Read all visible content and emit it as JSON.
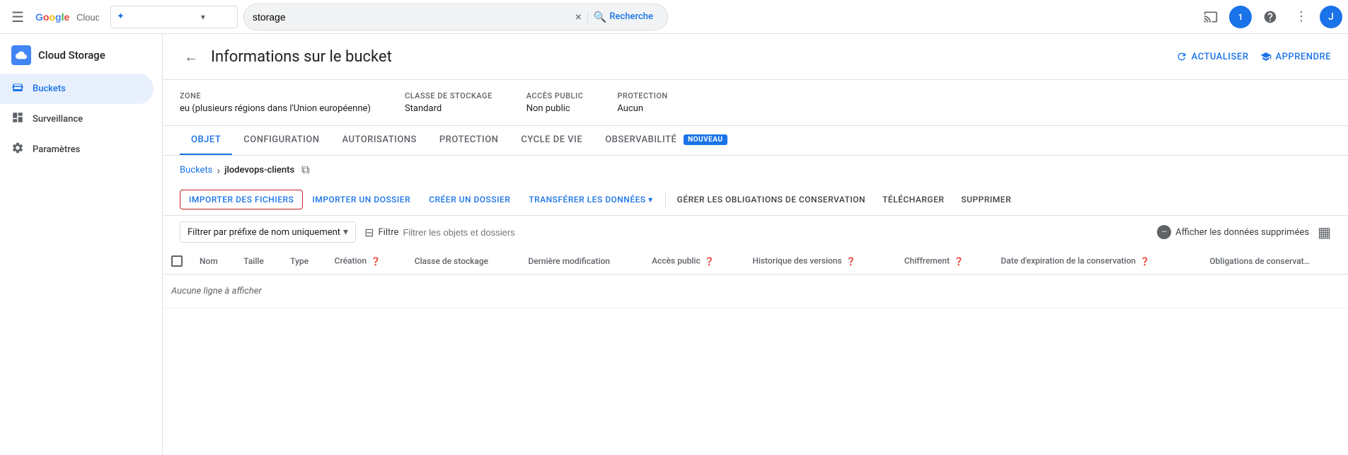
{
  "topbar": {
    "menu_icon": "☰",
    "logo_google": "Google",
    "logo_cloud": "Cloud",
    "project_selector_placeholder": "",
    "search_value": "storage",
    "search_clear_label": "×",
    "search_btn_label": "Recherche",
    "cast_icon": "⬡",
    "notification_count": "1",
    "help_icon": "?",
    "more_icon": "⋮",
    "avatar_letter": "J"
  },
  "sidebar": {
    "product_name": "Cloud Storage",
    "items": [
      {
        "id": "buckets",
        "label": "Buckets",
        "icon": "🪣",
        "active": true
      },
      {
        "id": "surveillance",
        "label": "Surveillance",
        "icon": "📊",
        "active": false
      },
      {
        "id": "parametres",
        "label": "Paramètres",
        "icon": "⚙",
        "active": false
      }
    ]
  },
  "page": {
    "back_label": "←",
    "title": "Informations sur le bucket",
    "refresh_label": "ACTUALISER",
    "learn_label": "APPRENDRE"
  },
  "bucket_info": {
    "zone_label": "Zone",
    "zone_value": "eu (plusieurs régions dans l'Union européenne)",
    "storage_class_label": "Classe de stockage",
    "storage_class_value": "Standard",
    "public_access_label": "Accès public",
    "public_access_value": "Non public",
    "protection_label": "Protection",
    "protection_value": "Aucun"
  },
  "tabs": [
    {
      "id": "objet",
      "label": "OBJET",
      "active": true,
      "badge": null
    },
    {
      "id": "configuration",
      "label": "CONFIGURATION",
      "active": false,
      "badge": null
    },
    {
      "id": "autorisations",
      "label": "AUTORISATIONS",
      "active": false,
      "badge": null
    },
    {
      "id": "protection",
      "label": "PROTECTION",
      "active": false,
      "badge": null
    },
    {
      "id": "cycle_de_vie",
      "label": "CYCLE DE VIE",
      "active": false,
      "badge": null
    },
    {
      "id": "observabilite",
      "label": "OBSERVABILITÉ",
      "active": false,
      "badge": "NOUVEAU"
    }
  ],
  "breadcrumb": {
    "buckets_label": "Buckets",
    "separator": "›",
    "current": "jlodevops-clients",
    "copy_icon": "⧉"
  },
  "toolbar": {
    "import_files_label": "IMPORTER DES FICHIERS",
    "import_folder_label": "IMPORTER UN DOSSIER",
    "create_folder_label": "CRÉER UN DOSSIER",
    "transfer_data_label": "TRANSFÉRER LES DONNÉES",
    "transfer_arrow": "▾",
    "manage_obligations_label": "GÉRER LES OBLIGATIONS DE CONSERVATION",
    "download_label": "TÉLÉCHARGER",
    "delete_label": "SUPPRIMER"
  },
  "filter_bar": {
    "filter_by_prefix_label": "Filtrer par préfixe de nom uniquement",
    "filter_icon": "⊟",
    "filter_label": "Filtre",
    "filter_placeholder": "Filtrer les objets et dossiers",
    "show_deleted_label": "Afficher les données supprimées",
    "density_icon": "▦"
  },
  "table": {
    "columns": [
      {
        "id": "nom",
        "label": "Nom"
      },
      {
        "id": "taille",
        "label": "Taille"
      },
      {
        "id": "type",
        "label": "Type"
      },
      {
        "id": "creation",
        "label": "Création",
        "has_help": true
      },
      {
        "id": "classe_stockage",
        "label": "Classe de stockage"
      },
      {
        "id": "derniere_modification",
        "label": "Dernière modification"
      },
      {
        "id": "acces_public",
        "label": "Accès public",
        "has_help": true
      },
      {
        "id": "historique_versions",
        "label": "Historique des versions",
        "has_help": true
      },
      {
        "id": "chiffrement",
        "label": "Chiffrement",
        "has_help": true
      },
      {
        "id": "date_expiration",
        "label": "Date d'expiration de la conservation",
        "has_help": true
      },
      {
        "id": "obligations",
        "label": "Obligations de conservat…"
      }
    ],
    "empty_message": "Aucune ligne à afficher",
    "rows": []
  }
}
